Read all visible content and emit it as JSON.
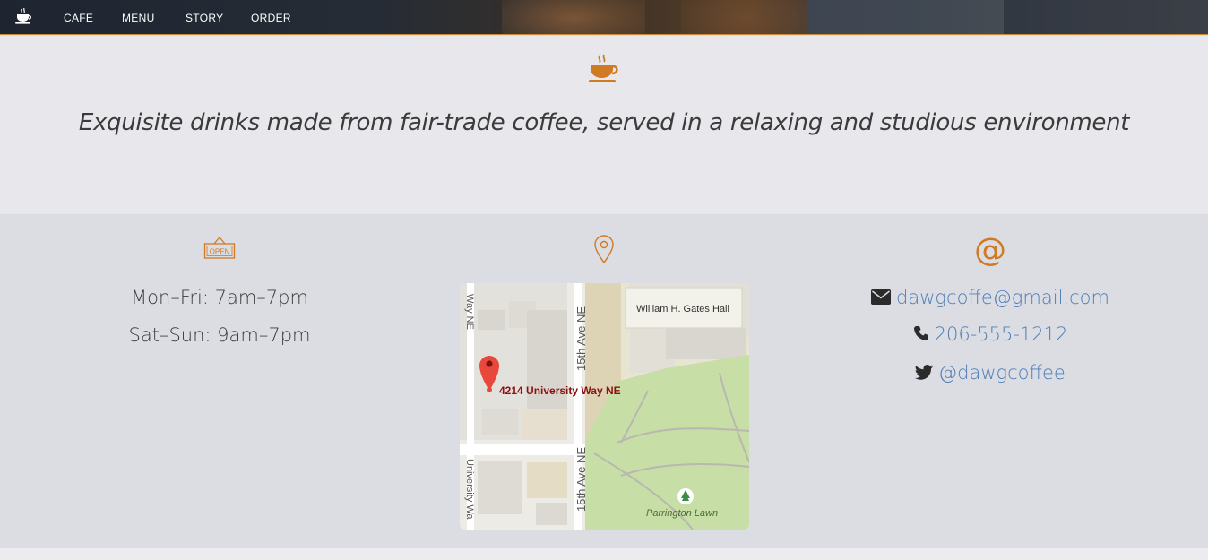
{
  "nav": {
    "brand_icon": "coffee-cup-icon",
    "items": [
      {
        "label": "CAFE"
      },
      {
        "label": "MENU"
      },
      {
        "label": "STORY"
      },
      {
        "label": "ORDER"
      }
    ]
  },
  "hero": {
    "icon": "coffee-cup-icon",
    "tagline": "Exquisite drinks made from fair-trade coffee, served in a relaxing and studious environment"
  },
  "hours": {
    "icon": "open-sign-icon",
    "open_sign_text": "OPEN",
    "lines": [
      "Mon–Fri: 7am–7pm",
      "Sat–Sun: 9am–7pm"
    ]
  },
  "location": {
    "icon": "map-pin-icon",
    "map": {
      "marker_label": "4214 University Way NE",
      "labels": {
        "building": "William H. Gates Hall",
        "street_top": "15th Ave NE",
        "street_bottom": "15th Ave NE",
        "way_top": "Way NE",
        "way_bottom": "University Wa",
        "park": "Parrington Lawn"
      }
    }
  },
  "contact": {
    "icon": "at-sign-icon",
    "at_symbol": "@",
    "email": "dawgcoffe@gmail.com",
    "phone": "206-555-1212",
    "twitter": "@dawgcoffee"
  },
  "colors": {
    "accent": "#d07a24",
    "link": "#4e7fb8",
    "text": "#3b3b3b"
  }
}
